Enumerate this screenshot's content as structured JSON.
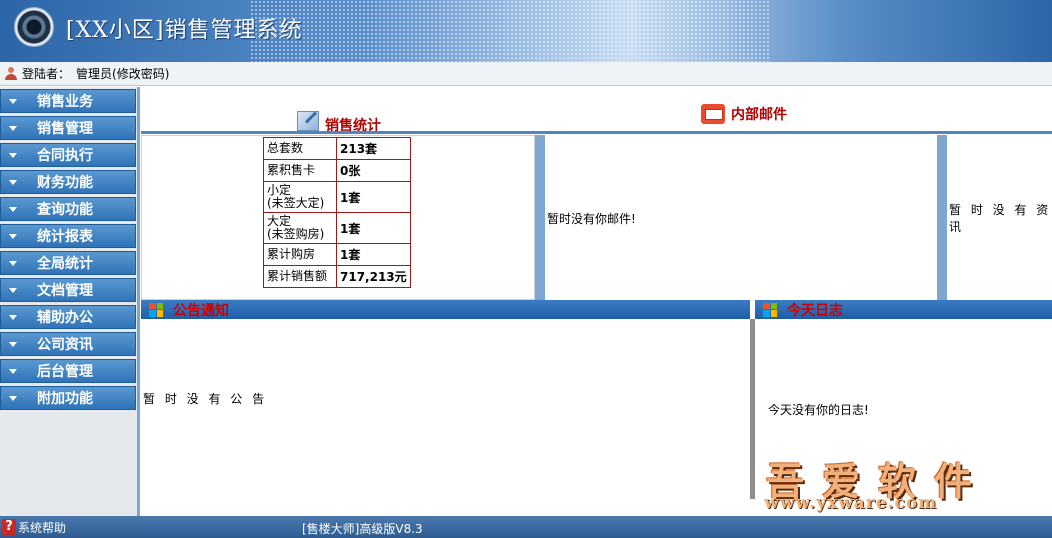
{
  "header": {
    "title": "[XX小区]销售管理系统"
  },
  "userbar": {
    "label": "登陆者：",
    "user": "管理员(修改密码)"
  },
  "sidebar": {
    "items": [
      {
        "label": "销售业务"
      },
      {
        "label": "销售管理"
      },
      {
        "label": "合同执行"
      },
      {
        "label": "财务功能"
      },
      {
        "label": "查询功能"
      },
      {
        "label": "统计报表"
      },
      {
        "label": "全局统计"
      },
      {
        "label": "文档管理"
      },
      {
        "label": "辅助办公"
      },
      {
        "label": "公司资讯"
      },
      {
        "label": "后台管理"
      },
      {
        "label": "附加功能"
      }
    ]
  },
  "stats": {
    "title": "销售统计",
    "rows": [
      {
        "label": "总套数",
        "value": "213套"
      },
      {
        "label": "累积售卡",
        "value": "0张"
      },
      {
        "label": "小定",
        "label2": "(未签大定)",
        "value": "1套"
      },
      {
        "label": "大定",
        "label2": "(未签购房)",
        "value": "1套"
      },
      {
        "label": "累计购房",
        "value": "1套"
      },
      {
        "label": "累计销售额",
        "value": "717,213元"
      }
    ]
  },
  "mail": {
    "title": "内部邮件",
    "empty": "暂时没有你邮件!"
  },
  "info": {
    "empty": "暂 时 没 有 资 讯"
  },
  "notice": {
    "title": "公告通知",
    "empty": "暂 时 没 有 公 告"
  },
  "log": {
    "title": "今天日志",
    "empty": "今天没有你的日志!"
  },
  "watermark": {
    "main": "吾爱软件",
    "url": "www.yxware.com"
  },
  "footer": {
    "help": "系统帮助",
    "version": "[售楼大师]高级版V8.3"
  }
}
